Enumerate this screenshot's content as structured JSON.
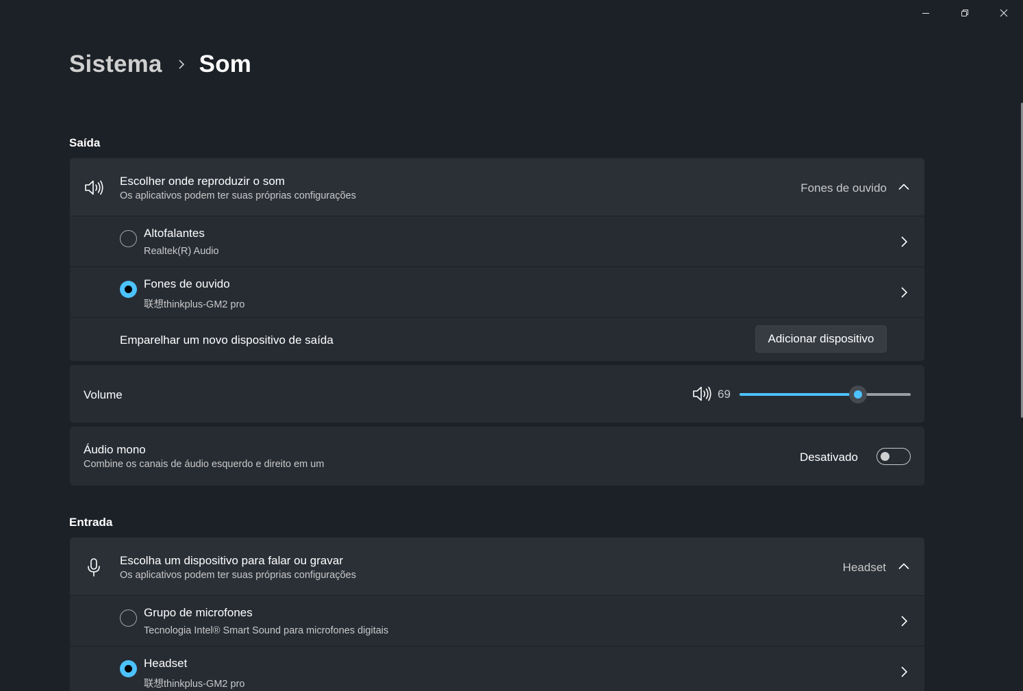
{
  "breadcrumb": {
    "parent": "Sistema",
    "current": "Som"
  },
  "output": {
    "section_title": "Saída",
    "chooser": {
      "icon": "speaker-icon",
      "title": "Escolher onde reproduzir o som",
      "subtitle": "Os aplicativos podem ter suas próprias configurações",
      "selected": "Fones de ouvido"
    },
    "devices": [
      {
        "name": "Altofalantes",
        "detail": "Realtek(R) Audio",
        "selected": false
      },
      {
        "name": "Fones de ouvido",
        "detail": "联想thinkplus-GM2 pro",
        "selected": true
      }
    ],
    "pair": {
      "label": "Emparelhar um novo dispositivo de saída",
      "button": "Adicionar dispositivo"
    }
  },
  "volume": {
    "label": "Volume",
    "value": "69",
    "level": 0.69
  },
  "mono": {
    "title": "Áudio mono",
    "subtitle": "Combine os canais de áudio esquerdo e direito em um",
    "state_label": "Desativado",
    "on": false
  },
  "input": {
    "section_title": "Entrada",
    "chooser": {
      "icon": "microphone-icon",
      "title": "Escolha um dispositivo para falar ou gravar",
      "subtitle": "Os aplicativos podem ter suas próprias configurações",
      "selected": "Headset"
    },
    "devices": [
      {
        "name": "Grupo de microfones",
        "detail": "Tecnologia Intel® Smart Sound para microfones digitais",
        "selected": false
      },
      {
        "name": "Headset",
        "detail": "联想thinkplus-GM2 pro",
        "selected": true
      }
    ]
  },
  "colors": {
    "background": "#1c2127",
    "card": "#272c33",
    "accent": "#4cc2ff"
  }
}
